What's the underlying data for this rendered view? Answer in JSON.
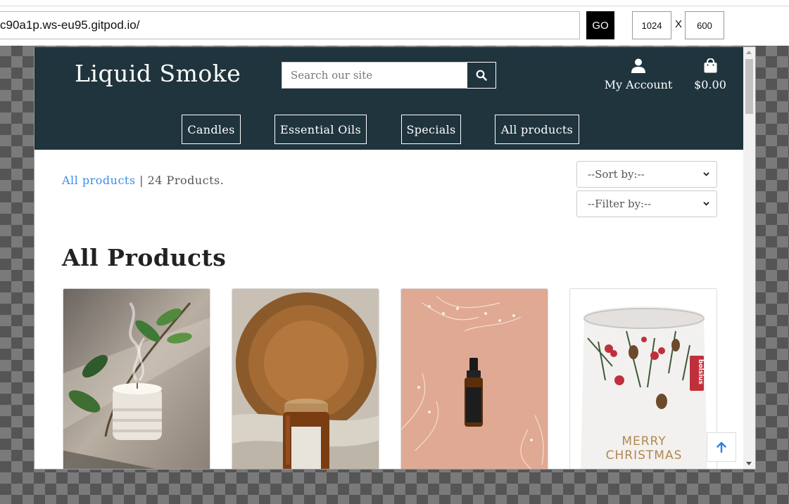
{
  "toolbar": {
    "url": "c90a1p.ws-eu95.gitpod.io/",
    "go_label": "GO",
    "width_value": "1024",
    "separator": "X",
    "height_value": "600"
  },
  "site": {
    "logo": "Liquid Smoke",
    "search_placeholder": "Search our site",
    "account_label": "My Account",
    "bag_total": "$0.00",
    "nav": [
      "Candles",
      "Essential Oils",
      "Specials",
      "All products"
    ],
    "breadcrumb_link": "All products",
    "breadcrumb_rest": " | 24 Products.",
    "sort_label": "--Sort by:--",
    "filter_label": "--Filter by:--",
    "heading": "All Products",
    "christmas_text": [
      "MERRY",
      "CHRISTMAS"
    ],
    "brand_tag": "bolsius"
  },
  "icons": {
    "search": "search-icon",
    "account": "user-icon",
    "bag": "shopping-bag-icon",
    "back_to_top": "arrow-up-icon",
    "select": "chevron-down-icon"
  },
  "colors": {
    "header_bg": "#1f343d",
    "link": "#3a8ee6",
    "go_button": "#000000"
  }
}
